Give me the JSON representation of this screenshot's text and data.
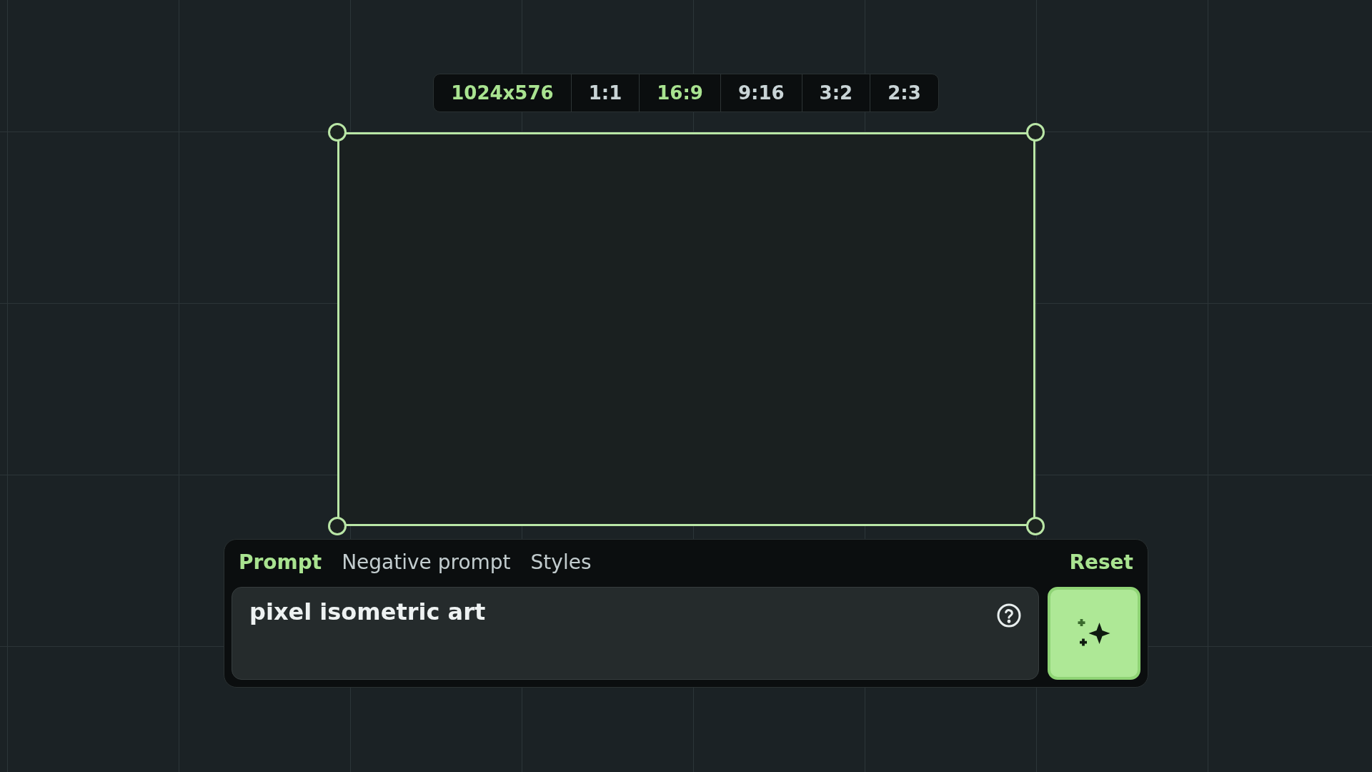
{
  "size_bar": {
    "items": [
      {
        "kind": "readout",
        "label": "1024x576"
      },
      {
        "kind": "ratio",
        "label": "1:1",
        "selected": false
      },
      {
        "kind": "ratio",
        "label": "16:9",
        "selected": true
      },
      {
        "kind": "ratio",
        "label": "9:16",
        "selected": false
      },
      {
        "kind": "ratio",
        "label": "3:2",
        "selected": false
      },
      {
        "kind": "ratio",
        "label": "2:3",
        "selected": false
      }
    ]
  },
  "prompt_panel": {
    "tabs": [
      {
        "label": "Prompt",
        "selected": true
      },
      {
        "label": "Negative prompt",
        "selected": false
      },
      {
        "label": "Styles",
        "selected": false
      }
    ],
    "reset": "Reset",
    "prompt": {
      "value": "pixel isometric art"
    }
  }
}
